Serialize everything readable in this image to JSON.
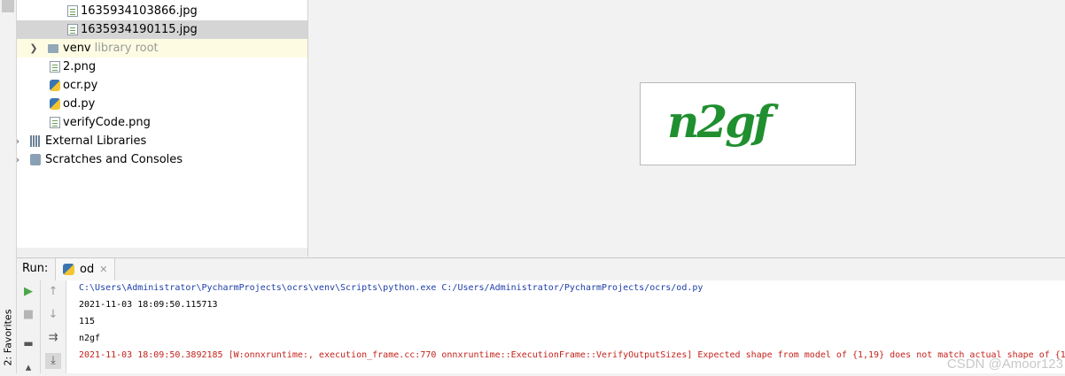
{
  "sidebar": {
    "favorites_label": "2: Favorites"
  },
  "project_tree": {
    "items": [
      {
        "label": "1635934103866.jpg",
        "suffix": "",
        "icon": "image-file-icon"
      },
      {
        "label": "1635934190115.jpg",
        "suffix": "",
        "icon": "image-file-icon"
      },
      {
        "label": "venv",
        "suffix": "library root",
        "icon": "folder-icon"
      },
      {
        "label": "2.png",
        "suffix": "",
        "icon": "image-file-icon"
      },
      {
        "label": "ocr.py",
        "suffix": "",
        "icon": "python-file-icon"
      },
      {
        "label": "od.py",
        "suffix": "",
        "icon": "python-file-icon"
      },
      {
        "label": "verifyCode.png",
        "suffix": "",
        "icon": "image-file-icon"
      },
      {
        "label": "External Libraries",
        "suffix": "",
        "icon": "libraries-icon"
      },
      {
        "label": "Scratches and Consoles",
        "suffix": "",
        "icon": "scratches-icon"
      }
    ]
  },
  "editor": {
    "captcha_text": "n2gf"
  },
  "run_panel": {
    "label": "Run:",
    "tab_label": "od",
    "close_glyph": "✕"
  },
  "console": {
    "lines": [
      "C:\\Users\\Administrator\\PycharmProjects\\ocrs\\venv\\Scripts\\python.exe C:/Users/Administrator/PycharmProjects/ocrs/od.py",
      "2021-11-03 18:09:50.115713",
      "115",
      "n2gf",
      "2021-11-03 18:09:50.3892185 [W:onnxruntime:, execution_frame.cc:770 onnxruntime::ExecutionFrame::VerifyOutputSizes] Expected shape from model of {1,19} does not match actual shape of {1,"
    ]
  },
  "watermark": "CSDN @Amoor123",
  "colors": {
    "selection": "#d5d5d5",
    "library_root_highlight": "#fdfce3",
    "console_command": "#1c3da8",
    "console_error": "#c4221b",
    "captcha_green": "#1f8f2f",
    "run_green": "#4aa84a"
  }
}
